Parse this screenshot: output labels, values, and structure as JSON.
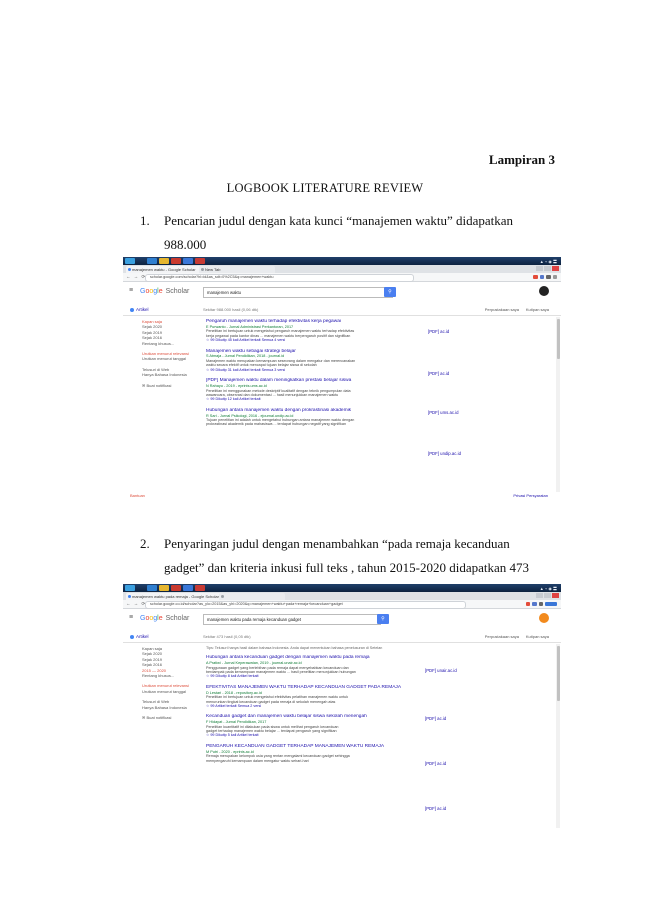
{
  "document": {
    "appendix_label": "Lampiran 3",
    "title": "LOGBOOK LITERATURE REVIEW",
    "items": [
      {
        "number": "1.",
        "text_line1": "Pencarian judul dengan kata kunci “manajemen waktu” didapatkan",
        "text_line2": "988.000"
      },
      {
        "number": "2.",
        "text_line1": "Penyaringan  judul dengan menambahkan “pada remaja kecanduan",
        "text_line2": "gadget” dan kriteria inkusi full teks , tahun 2015-2020 didapatkan  473"
      }
    ]
  },
  "screenshot1": {
    "tabs": [
      "manajemen waktu - Google Scholar",
      "New Tab"
    ],
    "url": "scholar.google.com/scholar?hl=id&as_sdt=0%2C5&q=manajemen+waktu",
    "logo_scholar": "Scholar",
    "query": "manajemen waktu",
    "articles_label": "Artikel",
    "result_count": "Sekitar 988.000 hasil (0,06 dtk)",
    "my_library": "Perpustakaan saya",
    "my_citations": "Kutipan saya",
    "sidebar_groups": [
      [
        "Kapan saja",
        "Sejak 2020",
        "Sejak 2019",
        "Sejak 2016",
        "Rentang khusus..."
      ],
      [
        "Urutkan menurut relevansi",
        "Urutkan menurut tanggal"
      ],
      [
        "Telusuri di Web",
        "Hanya Bahasa Indonesia"
      ],
      [
        "Buat notifikasi"
      ]
    ],
    "results": [
      {
        "title": "Pengaruh manajemen waktu terhadap efektivitas kerja pegawai",
        "meta": "E Purwanto - Jurnal Administrasi Perkantoran, 2017",
        "snip1": "Penelitian ini bertujuan untuk mengetahui pengaruh manajemen waktu terhadap efektivitas",
        "snip2": "kerja pegawai pada kantor dinas ... manajemen waktu berpengaruh positif dan signifikan",
        "links": "☆  99  Dikutip 45 kali  Artikel terkait  Semua 4 versi",
        "pdf": "[PDF] ac.id"
      },
      {
        "title": "Manajemen waktu sebagai strategi belajar",
        "meta": "S Atmaja - Jurnal Pendidikan, 2018 - journal.id",
        "snip1": "Manajemen waktu merupakan kemampuan seseorang dalam mengatur dan merencanakan",
        "snip2": "waktu secara efektif untuk mencapai tujuan belajar siswa di sekolah",
        "links": "☆  99  Dikutip 31 kali  Artikel terkait  Semua 3 versi",
        "pdf": "[PDF] ac.id"
      },
      {
        "title": "[PDF] Manajemen waktu dalam meningkatkan prestasi belajar siswa",
        "meta": "N Rahayu - 2019 - eprints.ums.ac.id",
        "snip1": "Penelitian ini menggunakan metode deskriptif kualitatif dengan teknik pengumpulan data",
        "snip2": "wawancara, observasi dan dokumentasi ... hasil menunjukkan manajemen waktu",
        "links": "☆  99  Dikutip 12 kali  Artikel terkait",
        "pdf": "[PDF] ums.ac.id"
      },
      {
        "title": "Hubungan antara manajemen waktu dengan prokrastinasi akademik",
        "meta": "R Sari - Jurnal Psikologi, 2016 - ejournal.undip.ac.id",
        "snip1": "Tujuan penelitian ini adalah untuk mengetahui hubungan antara manajemen waktu dengan",
        "snip2": "prokrastinasi akademik pada mahasiswa ... terdapat hubungan negatif yang signifikan",
        "links": "☆  99  Dikutip 27 kali  Artikel terkait  Semua 5 versi",
        "pdf": "[PDF] undip.ac.id"
      }
    ],
    "footer_help": "Bantuan",
    "footer_right": "Privasi  Persyaratan"
  },
  "screenshot2": {
    "tabs": [
      "manajemen waktu pada remaja - Google Scholar",
      ""
    ],
    "url": "scholar.google.co.id/scholar?as_ylo=2015&as_yhi=2020&q=manajemen+waktu+pada+remaja+kecanduan+gadget",
    "logo_scholar": "Scholar",
    "query": "manajemen waktu pada remaja kecanduan gadget",
    "articles_label": "Artikel",
    "result_count": "Sekitar 473 hasil (0,05 dtk)",
    "my_library": "Perpustakaan saya",
    "my_citations": "Kutipan saya",
    "sidebar_groups": [
      [
        "Kapan saja",
        "Sejak 2020",
        "Sejak 2019",
        "Sejak 2016",
        "2015 — 2020",
        "Rentang khusus..."
      ],
      [
        "Urutkan menurut relevansi",
        "Urutkan menurut tanggal"
      ],
      [
        "Telusuri di Web",
        "Hanya Bahasa Indonesia"
      ],
      [
        "Buat notifikasi"
      ]
    ],
    "notice": "Tips: Telusuri hanya hasil dalam bahasa Indonesia. Anda dapat menentukan bahasa penelusuran di Setelan",
    "results": [
      {
        "title": "Hubungan antara kecanduan gadget dengan manajemen waktu pada remaja",
        "meta": "A Pratiwi - Jurnal Keperawatan, 2019 - journal.unair.ac.id",
        "snip1": "Penggunaan gadget yang berlebihan pada remaja dapat menyebabkan kecanduan dan",
        "snip2": "berdampak pada kemampuan manajemen waktu ... hasil penelitian menunjukkan hubungan",
        "links": "☆  99  Dikutip 8 kali  Artikel terkait",
        "pdf": "[PDF] unair.ac.id"
      },
      {
        "title": "EFEKTIVITAS MANAJEMEN WAKTU TERHADAP KECANDUAN GADGET PADA REMAJA",
        "meta": "D Lestari - 2018 - repository.ac.id",
        "snip1": "Penelitian ini bertujuan untuk mengetahui efektivitas pelatihan manajemen waktu untuk",
        "snip2": "menurunkan tingkat kecanduan gadget pada remaja di sekolah menengah atas",
        "links": "☆  99  Artikel terkait  Semua 2 versi",
        "pdf": "[PDF] ac.id"
      },
      {
        "title": "Kecanduan gadget dan manajemen waktu belajar siswa sekolah menengah",
        "meta": "F Hidayat - Jurnal Pendidikan, 2017",
        "snip1": "Penelitian kuantitatif ini dilakukan pada siswa untuk melihat pengaruh kecanduan",
        "snip2": "gadget terhadap manajemen waktu belajar ... terdapat pengaruh yang signifikan",
        "links": "☆  99  Dikutip 5 kali  Artikel terkait",
        "pdf": "[PDF] ac.id"
      },
      {
        "title": "PENGARUH KECANDUAN GADGET TERHADAP MANAJEMEN WAKTU REMAJA",
        "meta": "M Putri - 2020 - eprints.ac.id",
        "snip1": "Remaja merupakan kelompok usia yang rentan mengalami kecanduan gadget sehingga",
        "snip2": "mempengaruhi kemampuan dalam mengatur waktu sehari-hari",
        "links": "☆  99  Artikel terkait",
        "pdf": "[PDF] ac.id"
      }
    ]
  }
}
